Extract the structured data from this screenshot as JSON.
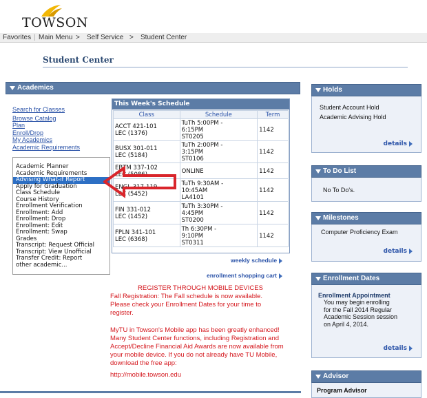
{
  "header": {
    "logo_text": "TOWSON",
    "nav": {
      "favorites": "Favorites",
      "main_menu": "Main Menu",
      "sep": ">",
      "self_service": "Self Service",
      "student_center": "Student Center"
    }
  },
  "page_title": "Student Center",
  "academics": {
    "title": "Academics",
    "links": [
      "Search for Classes",
      "Browse Catalog",
      "Plan",
      "Enroll/Drop",
      "My Academics",
      "Academic Requirements"
    ],
    "dropdown_options": [
      "Academic Planner",
      "Academic Requirements",
      "Advising What-if Report",
      "Apply for Graduation",
      "Class Schedule",
      "Course History",
      "Enrollment Verification",
      "Enrollment: Add",
      "Enrollment: Drop",
      "Enrollment: Edit",
      "Enrollment: Swap",
      "Grades",
      "Transcript: Request Official",
      "Transcript: View Unofficial",
      "Transfer Credit: Report",
      "other academic..."
    ],
    "dropdown_selected_index": 2,
    "schedule": {
      "title": "This Week's Schedule",
      "headers": [
        "Class",
        "Schedule",
        "Term"
      ],
      "rows": [
        {
          "class1": "ACCT 421-101",
          "class2": "LEC (1376)",
          "s1": "TuTh 5:00PM -",
          "s2": "6:15PM",
          "s3": "ST0205",
          "term": "1142"
        },
        {
          "class1": "BUSX 301-011",
          "class2": "LEC (5184)",
          "s1": "TuTh 2:00PM -",
          "s2": "3:15PM",
          "s3": "ST0106",
          "term": "1142"
        },
        {
          "class1": "EBTM 337-102",
          "class2": "LEC (5086)",
          "s1": "ONLINE",
          "s2": "",
          "s3": "",
          "term": "1142"
        },
        {
          "class1": "ENGL 317-119",
          "class2": "LEC (5452)",
          "s1": "TuTh 9:30AM -",
          "s2": "10:45AM",
          "s3": "LA4101",
          "term": "1142"
        },
        {
          "class1": "FIN 331-012",
          "class2": "LEC (1452)",
          "s1": "TuTh 3:30PM -",
          "s2": "4:45PM",
          "s3": "ST0200",
          "term": "1142"
        },
        {
          "class1": "FPLN 341-101",
          "class2": "LEC (6368)",
          "s1": "Th 6:30PM -",
          "s2": "9:10PM",
          "s3": "ST0311",
          "term": "1142"
        }
      ]
    },
    "weekly_schedule_link": "weekly schedule",
    "shopping_cart_link": "enrollment shopping cart",
    "notice": {
      "heading": "REGISTER THROUGH MOBILE DEVICES",
      "p1": [
        "Fall Registration: The Fall schedule is now available.",
        "Please check your Enrollment Dates for your time to",
        "register."
      ],
      "p2": [
        "MyTU in Towson's Mobile app has been greatly enhanced!",
        "Many Student Center functions, including Registration and",
        "Accept/Decline Financial Aid Awards are now available from",
        "your mobile device. If you do not already have TU Mobile,",
        "download the free app:"
      ],
      "url": "http://mobile.towson.edu"
    }
  },
  "holds": {
    "title": "Holds",
    "items": [
      "Student Account Hold",
      "Academic Advising Hold"
    ],
    "details": "details"
  },
  "todo": {
    "title": "To Do List",
    "text": "No To Do's.",
    "details": "details"
  },
  "milestones": {
    "title": "Milestones",
    "text": "Computer Proficiency Exam",
    "details": "details"
  },
  "enrollment_dates": {
    "title": "Enrollment Dates",
    "subtitle": "Enrollment Appointment",
    "lines": [
      "You may begin enrolling",
      "for the Fall 2014 Regular",
      "Academic Session session",
      "on April 4, 2014."
    ],
    "details": "details"
  },
  "advisor": {
    "title": "Advisor",
    "subtitle": "Program Advisor"
  },
  "colors": {
    "bar": "#5c7ca6",
    "link": "#2b53a8",
    "notice": "#d4161c",
    "annotation_arrow": "#d9252b"
  }
}
